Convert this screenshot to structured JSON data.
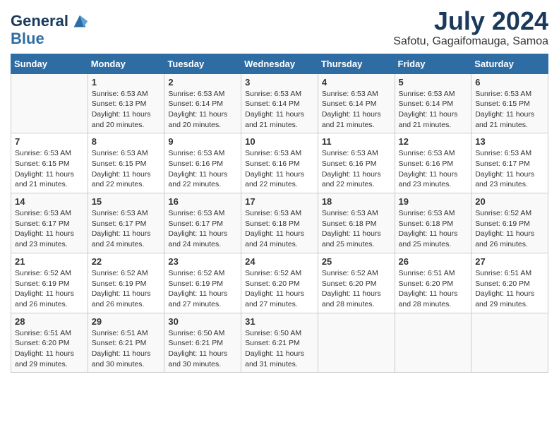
{
  "header": {
    "logo_line1": "General",
    "logo_line2": "Blue",
    "month_year": "July 2024",
    "location": "Safotu, Gagaifomauga, Samoa"
  },
  "weekdays": [
    "Sunday",
    "Monday",
    "Tuesday",
    "Wednesday",
    "Thursday",
    "Friday",
    "Saturday"
  ],
  "weeks": [
    [
      {
        "day": "",
        "info": ""
      },
      {
        "day": "1",
        "info": "Sunrise: 6:53 AM\nSunset: 6:13 PM\nDaylight: 11 hours\nand 20 minutes."
      },
      {
        "day": "2",
        "info": "Sunrise: 6:53 AM\nSunset: 6:14 PM\nDaylight: 11 hours\nand 20 minutes."
      },
      {
        "day": "3",
        "info": "Sunrise: 6:53 AM\nSunset: 6:14 PM\nDaylight: 11 hours\nand 21 minutes."
      },
      {
        "day": "4",
        "info": "Sunrise: 6:53 AM\nSunset: 6:14 PM\nDaylight: 11 hours\nand 21 minutes."
      },
      {
        "day": "5",
        "info": "Sunrise: 6:53 AM\nSunset: 6:14 PM\nDaylight: 11 hours\nand 21 minutes."
      },
      {
        "day": "6",
        "info": "Sunrise: 6:53 AM\nSunset: 6:15 PM\nDaylight: 11 hours\nand 21 minutes."
      }
    ],
    [
      {
        "day": "7",
        "info": "Sunrise: 6:53 AM\nSunset: 6:15 PM\nDaylight: 11 hours\nand 21 minutes."
      },
      {
        "day": "8",
        "info": "Sunrise: 6:53 AM\nSunset: 6:15 PM\nDaylight: 11 hours\nand 22 minutes."
      },
      {
        "day": "9",
        "info": "Sunrise: 6:53 AM\nSunset: 6:16 PM\nDaylight: 11 hours\nand 22 minutes."
      },
      {
        "day": "10",
        "info": "Sunrise: 6:53 AM\nSunset: 6:16 PM\nDaylight: 11 hours\nand 22 minutes."
      },
      {
        "day": "11",
        "info": "Sunrise: 6:53 AM\nSunset: 6:16 PM\nDaylight: 11 hours\nand 22 minutes."
      },
      {
        "day": "12",
        "info": "Sunrise: 6:53 AM\nSunset: 6:16 PM\nDaylight: 11 hours\nand 23 minutes."
      },
      {
        "day": "13",
        "info": "Sunrise: 6:53 AM\nSunset: 6:17 PM\nDaylight: 11 hours\nand 23 minutes."
      }
    ],
    [
      {
        "day": "14",
        "info": "Sunrise: 6:53 AM\nSunset: 6:17 PM\nDaylight: 11 hours\nand 23 minutes."
      },
      {
        "day": "15",
        "info": "Sunrise: 6:53 AM\nSunset: 6:17 PM\nDaylight: 11 hours\nand 24 minutes."
      },
      {
        "day": "16",
        "info": "Sunrise: 6:53 AM\nSunset: 6:17 PM\nDaylight: 11 hours\nand 24 minutes."
      },
      {
        "day": "17",
        "info": "Sunrise: 6:53 AM\nSunset: 6:18 PM\nDaylight: 11 hours\nand 24 minutes."
      },
      {
        "day": "18",
        "info": "Sunrise: 6:53 AM\nSunset: 6:18 PM\nDaylight: 11 hours\nand 25 minutes."
      },
      {
        "day": "19",
        "info": "Sunrise: 6:53 AM\nSunset: 6:18 PM\nDaylight: 11 hours\nand 25 minutes."
      },
      {
        "day": "20",
        "info": "Sunrise: 6:52 AM\nSunset: 6:19 PM\nDaylight: 11 hours\nand 26 minutes."
      }
    ],
    [
      {
        "day": "21",
        "info": "Sunrise: 6:52 AM\nSunset: 6:19 PM\nDaylight: 11 hours\nand 26 minutes."
      },
      {
        "day": "22",
        "info": "Sunrise: 6:52 AM\nSunset: 6:19 PM\nDaylight: 11 hours\nand 26 minutes."
      },
      {
        "day": "23",
        "info": "Sunrise: 6:52 AM\nSunset: 6:19 PM\nDaylight: 11 hours\nand 27 minutes."
      },
      {
        "day": "24",
        "info": "Sunrise: 6:52 AM\nSunset: 6:20 PM\nDaylight: 11 hours\nand 27 minutes."
      },
      {
        "day": "25",
        "info": "Sunrise: 6:52 AM\nSunset: 6:20 PM\nDaylight: 11 hours\nand 28 minutes."
      },
      {
        "day": "26",
        "info": "Sunrise: 6:51 AM\nSunset: 6:20 PM\nDaylight: 11 hours\nand 28 minutes."
      },
      {
        "day": "27",
        "info": "Sunrise: 6:51 AM\nSunset: 6:20 PM\nDaylight: 11 hours\nand 29 minutes."
      }
    ],
    [
      {
        "day": "28",
        "info": "Sunrise: 6:51 AM\nSunset: 6:20 PM\nDaylight: 11 hours\nand 29 minutes."
      },
      {
        "day": "29",
        "info": "Sunrise: 6:51 AM\nSunset: 6:21 PM\nDaylight: 11 hours\nand 30 minutes."
      },
      {
        "day": "30",
        "info": "Sunrise: 6:50 AM\nSunset: 6:21 PM\nDaylight: 11 hours\nand 30 minutes."
      },
      {
        "day": "31",
        "info": "Sunrise: 6:50 AM\nSunset: 6:21 PM\nDaylight: 11 hours\nand 31 minutes."
      },
      {
        "day": "",
        "info": ""
      },
      {
        "day": "",
        "info": ""
      },
      {
        "day": "",
        "info": ""
      }
    ]
  ]
}
